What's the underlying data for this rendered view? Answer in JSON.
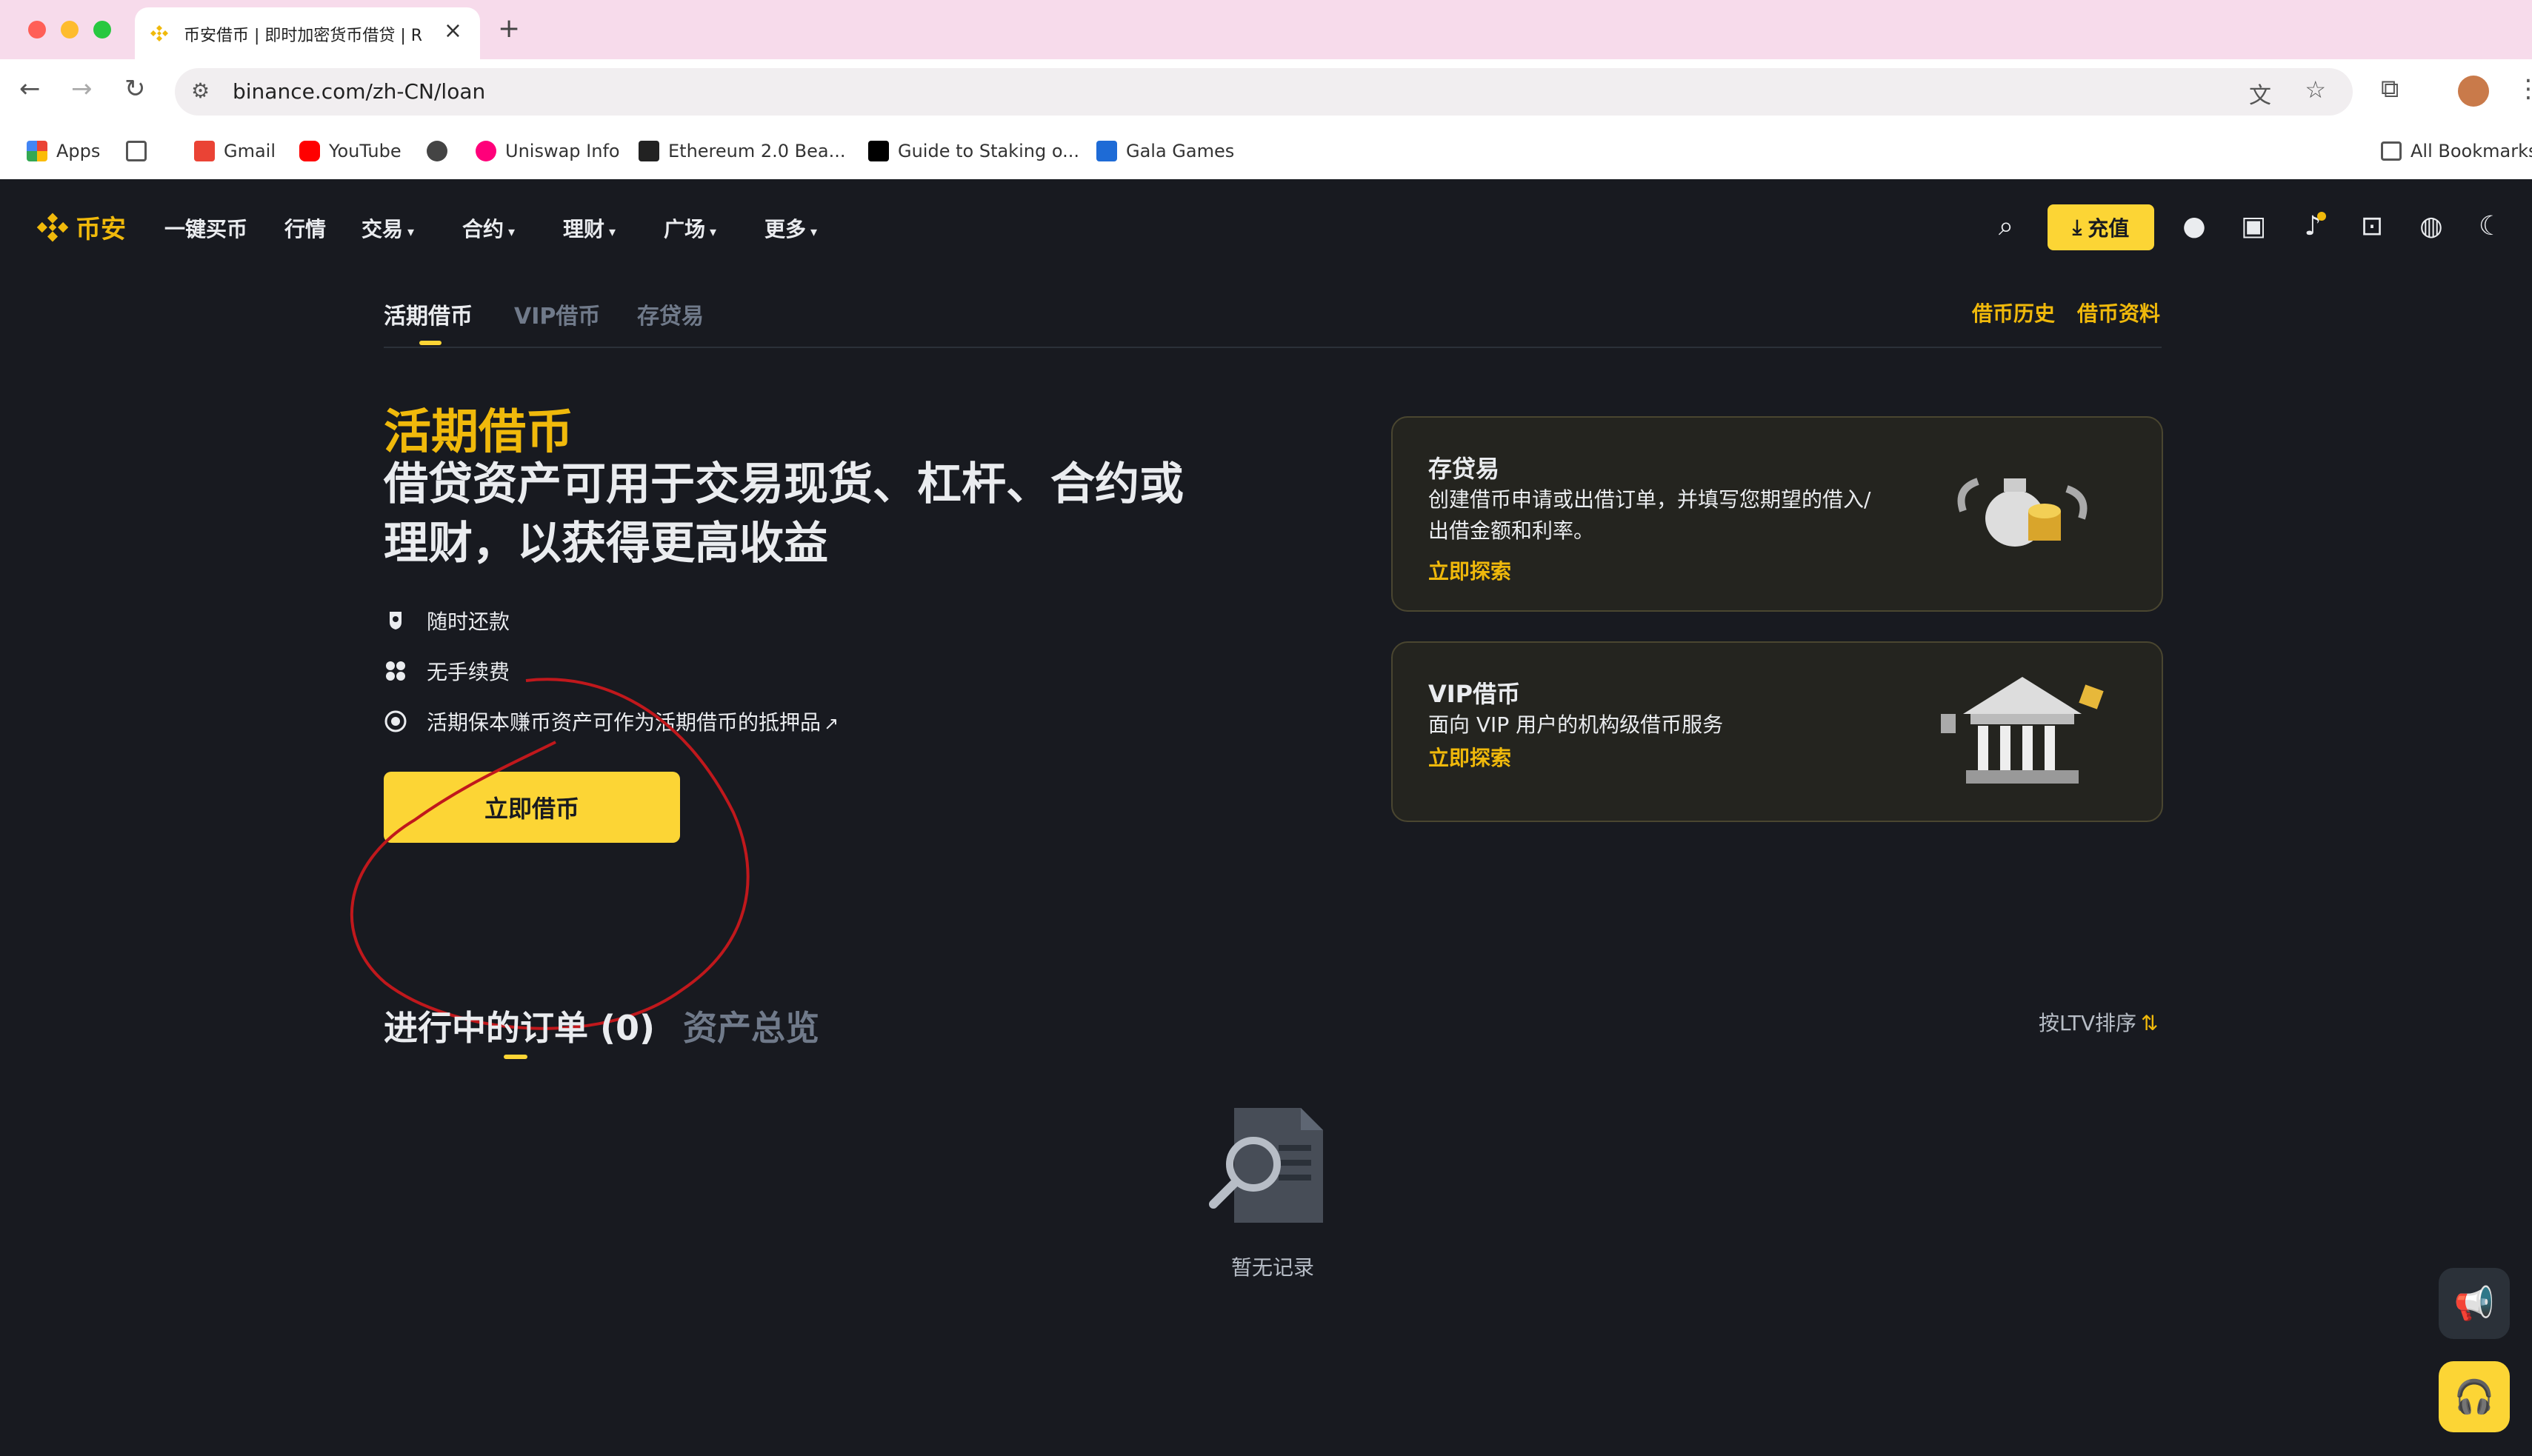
{
  "browser": {
    "tab_title": "币安借币 | 即时加密货币借贷 | R",
    "url": "binance.com/zh-CN/loan",
    "bookmarks": [
      "Apps",
      "Gmail",
      "YouTube",
      "Uniswap Info",
      "Ethereum 2.0 Bea...",
      "Guide to Staking o...",
      "Gala Games"
    ],
    "all_bookmarks": "All Bookmarks"
  },
  "nav": {
    "logo": "币安",
    "items": [
      "一键买币",
      "行情",
      "交易",
      "合约",
      "理财",
      "广场",
      "更多"
    ],
    "deposit": "充值"
  },
  "subtabs": {
    "items": [
      "活期借币",
      "VIP借币",
      "存贷易"
    ],
    "right": [
      "借币历史",
      "借币资料"
    ]
  },
  "hero": {
    "title": "活期借币",
    "subtitle": "借贷资产可用于交易现货、杠杆、合约或理财，以获得更高收益",
    "features": [
      "随时还款",
      "无手续费",
      "活期保本赚币资产可作为活期借币的抵押品"
    ],
    "cta": "立即借币"
  },
  "cards": [
    {
      "title": "存贷易",
      "desc": "创建借币申请或出借订单，并填写您期望的借入/出借金额和利率。",
      "link": "立即探索"
    },
    {
      "title": "VIP借币",
      "desc": "面向 VIP 用户的机构级借币服务",
      "link": "立即探索"
    }
  ],
  "orders": {
    "title": "进行中的订单 (0)",
    "assets": "资产总览",
    "sort": "按LTV排序",
    "empty": "暂无记录"
  },
  "colors": {
    "accent": "#fcd535",
    "accent_text": "#f0b90b",
    "bg": "#181a20"
  }
}
